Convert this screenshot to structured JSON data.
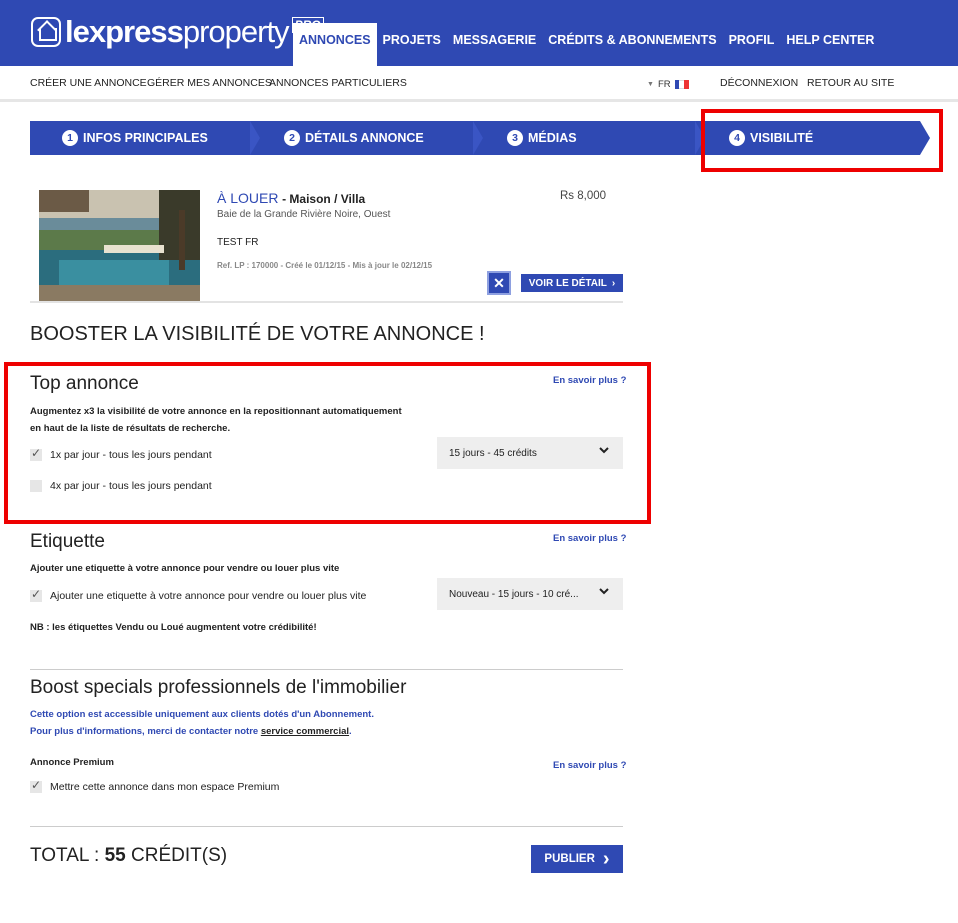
{
  "brand": {
    "name_bold": "lexpress",
    "name_light": "property",
    "tag": "PRO"
  },
  "main_nav": [
    {
      "label": "ANNONCES",
      "active": true
    },
    {
      "label": "PROJETS"
    },
    {
      "label": "MESSAGERIE"
    },
    {
      "label": "CRÉDITS & ABONNEMENTS"
    },
    {
      "label": "PROFIL"
    },
    {
      "label": "HELP CENTER"
    }
  ],
  "sub_nav": {
    "left": [
      "CRÉER UNE ANNONCE",
      "GÉRER MES ANNONCES",
      "ANNONCES PARTICULIERS"
    ],
    "language": "FR",
    "right": [
      "DÉCONNEXION",
      "RETOUR AU SITE"
    ]
  },
  "steps": [
    {
      "num": "1",
      "label": "INFOS PRINCIPALES"
    },
    {
      "num": "2",
      "label": "DÉTAILS ANNONCE"
    },
    {
      "num": "3",
      "label": "MÉDIAS"
    },
    {
      "num": "4",
      "label": "VISIBILITÉ"
    }
  ],
  "listing": {
    "type": "À LOUER",
    "category": "- Maison / Villa",
    "location": "Baie de la Grande Rivière Noire, Ouest",
    "title": "TEST FR",
    "ref": "Ref. LP : 170000 - Créé le 01/12/15 - Mis à jour le 02/12/15",
    "price": "Rs 8,000",
    "close_label": "✕",
    "detail_label": "VOIR LE DÉTAIL"
  },
  "boost_heading": "BOOSTER LA VISIBILITÉ DE VOTRE ANNONCE !",
  "learn_more": "En savoir plus ?",
  "top_annonce": {
    "title": "Top annonce",
    "desc_line1": "Augmentez x3 la visibilité de votre annonce en la repositionnant automatiquement",
    "desc_line2": "en haut de la liste de résultats de recherche.",
    "opt1": "1x par jour - tous les jours pendant",
    "opt2": "4x par jour - tous les jours pendant",
    "select": "15 jours - 45 crédits"
  },
  "etiquette": {
    "title": "Etiquette",
    "desc": "Ajouter une etiquette à votre annonce pour vendre ou louer plus vite",
    "opt1": "Ajouter une etiquette à votre annonce pour vendre ou louer plus vite",
    "select": "Nouveau - 15 jours - 10 cré...",
    "nb": "NB : les étiquettes Vendu ou Loué augmentent votre crédibilité!"
  },
  "pro": {
    "title": "Boost specials professionnels de l'immobilier",
    "line1": "Cette option est accessible uniquement aux clients dotés d'un Abonnement.",
    "line2_pre": "Pour plus d'informations, merci de contacter notre ",
    "line2_link": "service commercial",
    "line2_post": ".",
    "premium_label": "Annonce Premium",
    "premium_opt": "Mettre cette annonce dans mon espace Premium"
  },
  "total": {
    "label": "TOTAL : ",
    "value": "55",
    "unit": " CRÉDIT(S)"
  },
  "publish_label": "PUBLIER",
  "colors": {
    "brand_blue": "#2f49b3",
    "highlight_red": "#e00000"
  }
}
